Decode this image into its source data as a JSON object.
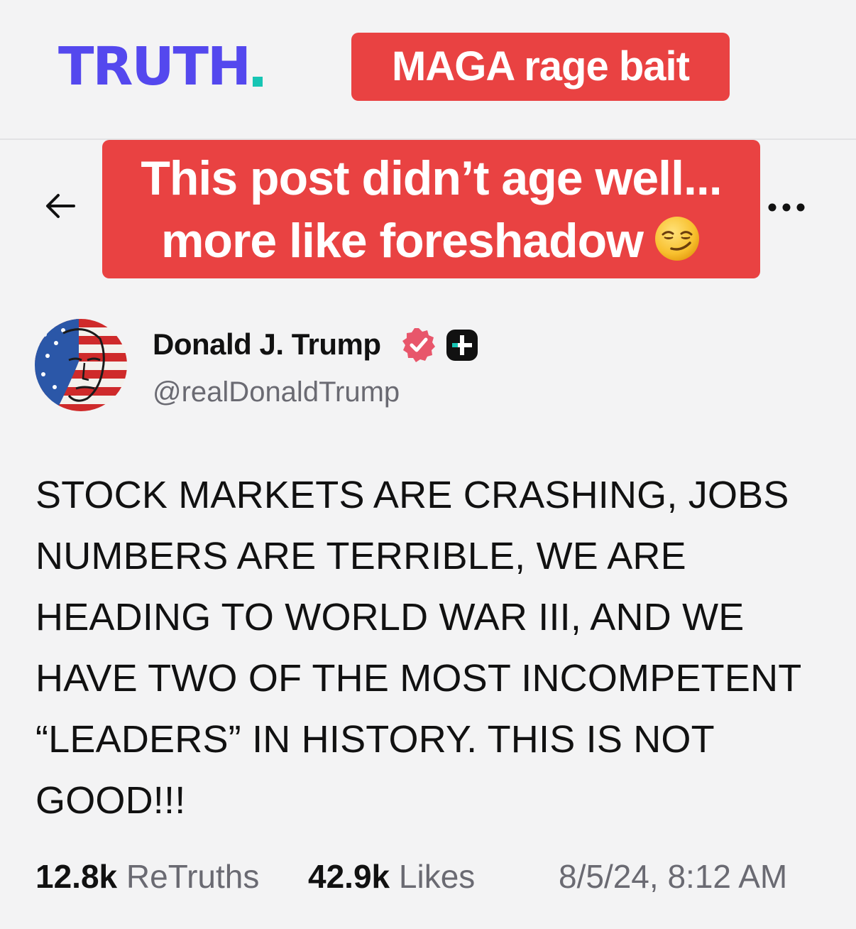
{
  "header": {
    "logo_text": "TRUTH",
    "overlay_top": "MAGA rage bait"
  },
  "overlay_main": {
    "line1": "This post didn’t age well...",
    "line2": "more like foreshadow",
    "emoji": "smirking-face-emoji"
  },
  "nav": {
    "back_icon": "arrow-left-icon",
    "more_icon": "more-horizontal-icon"
  },
  "author": {
    "name": "Donald J. Trump",
    "handle": "@realDonaldTrump",
    "verified_icon": "verified-badge-icon",
    "plus_icon": "truth-plus-badge-icon"
  },
  "post": {
    "lines": [
      "STOCK MARKETS ARE CRASHING, JOBS",
      "NUMBERS ARE TERRIBLE, WE ARE",
      "HEADING TO WORLD WAR III, AND WE",
      "HAVE TWO OF THE MOST INCOMPETENT",
      "“LEADERS” IN HISTORY. THIS IS NOT",
      "GOOD!!!"
    ]
  },
  "stats": {
    "retruths_count": "12.8k",
    "retruths_label": "ReTruths",
    "likes_count": "42.9k",
    "likes_label": "Likes",
    "timestamp": "8/5/24, 8:12 AM"
  },
  "colors": {
    "brand": "#5448ee",
    "brand_dot": "#17c5b4",
    "overlay_red": "#e94242",
    "background": "#f3f3f4",
    "muted_text": "#6a6a72",
    "verified_pink": "#e8566b"
  }
}
